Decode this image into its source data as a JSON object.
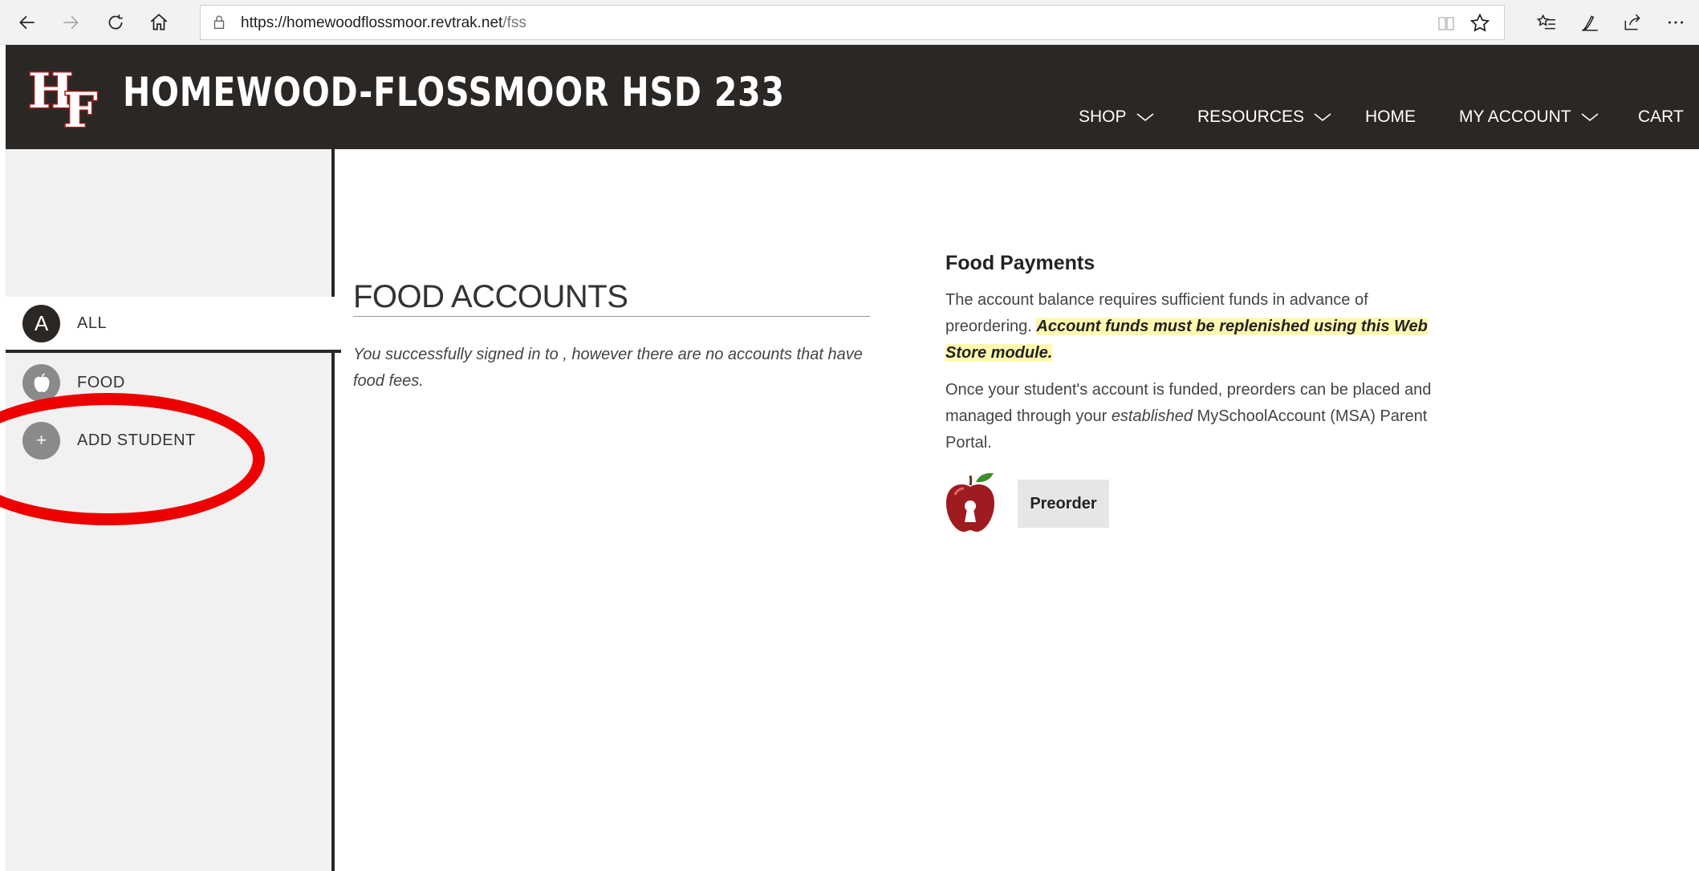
{
  "browser": {
    "url_domain": "https://homewoodflossmoor.revtrak.net",
    "url_path": "/fss"
  },
  "header": {
    "logo_text": "HF",
    "title": "HOMEWOOD-FLOSSMOOR HSD 233",
    "nav": [
      {
        "label": "SHOP",
        "has_dropdown": true
      },
      {
        "label": "RESOURCES",
        "has_dropdown": true
      },
      {
        "label": "HOME",
        "has_dropdown": false
      },
      {
        "label": "MY ACCOUNT",
        "has_dropdown": true
      },
      {
        "label": "CART",
        "has_dropdown": false
      }
    ]
  },
  "sidebar": {
    "items": [
      {
        "badge": "A",
        "label": "ALL",
        "active": true,
        "icon": "letter-badge"
      },
      {
        "badge": "",
        "label": "FOOD",
        "active": false,
        "icon": "apple-icon"
      },
      {
        "badge": "+",
        "label": "ADD STUDENT",
        "active": false,
        "icon": "plus-icon"
      }
    ]
  },
  "main": {
    "title": "FOOD ACCOUNTS",
    "message": "You successfully signed in to , however there are no accounts that have food fees."
  },
  "payments": {
    "heading": "Food Payments",
    "para1_start": "The account balance requires sufficient funds in advance of preordering. ",
    "para1_highlight": "Account funds must be replenished using this Web Store module.",
    "para2_start": "Once your student's account is funded, preorders can be placed and managed through your ",
    "para2_italic": "established",
    "para2_end": " MySchoolAccount (MSA) Parent Portal.",
    "button_label": "Preorder"
  },
  "colors": {
    "header_bg": "#2b2725",
    "sidebar_bg": "#f1f1f1",
    "highlight": "#fff8b0",
    "annotation": "#ee0000",
    "logo_red": "#a01e22"
  }
}
